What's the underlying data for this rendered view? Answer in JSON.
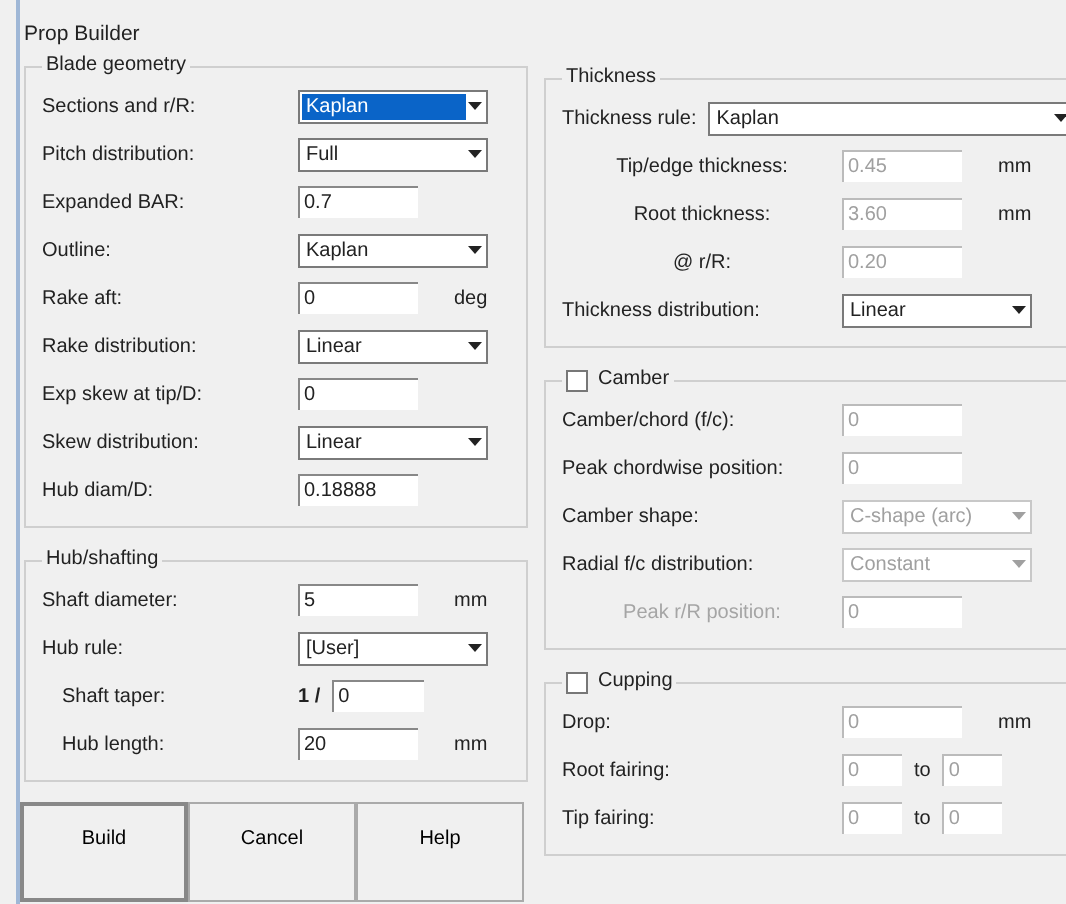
{
  "window": {
    "title": "Prop Builder"
  },
  "left_groups": [
    {
      "title": "Blade geometry",
      "rows": [
        {
          "label": "Sections and r/R:",
          "kind": "combo",
          "value": "Kaplan",
          "focused": true,
          "disabled": false,
          "indented": false
        },
        {
          "label": "Pitch distribution:",
          "kind": "combo",
          "value": "Full",
          "focused": false,
          "disabled": false,
          "indented": false
        },
        {
          "label": "Expanded BAR:",
          "kind": "text",
          "value": "0.7",
          "disabled": false,
          "indented": false
        },
        {
          "label": "Outline:",
          "kind": "combo",
          "value": "Kaplan",
          "focused": false,
          "disabled": false,
          "indented": false
        },
        {
          "label": "Rake aft:",
          "kind": "text",
          "value": "0",
          "unit": "deg",
          "disabled": false,
          "indented": false
        },
        {
          "label": "Rake distribution:",
          "kind": "combo",
          "value": "Linear",
          "focused": false,
          "disabled": false,
          "indented": false
        },
        {
          "label": "Exp skew at tip/D:",
          "kind": "text",
          "value": "0",
          "disabled": false,
          "indented": false
        },
        {
          "label": "Skew distribution:",
          "kind": "combo",
          "value": "Linear",
          "focused": false,
          "disabled": false,
          "indented": false
        },
        {
          "label": "Hub diam/D:",
          "kind": "text",
          "value": "0.18888",
          "disabled": false,
          "indented": false
        }
      ]
    },
    {
      "title": "Hub/shafting",
      "rows": [
        {
          "label": "Shaft diameter:",
          "kind": "text",
          "value": "5",
          "unit": "mm",
          "disabled": false,
          "indented": false
        },
        {
          "label": "Hub rule:",
          "kind": "combo",
          "value": "[User]",
          "focused": false,
          "disabled": false,
          "indented": false
        },
        {
          "label": "Shaft taper:",
          "kind": "ratio",
          "prefix": "1 /",
          "value": "0",
          "disabled": false,
          "indented": true
        },
        {
          "label": "Hub length:",
          "kind": "text",
          "value": "20",
          "unit": "mm",
          "disabled": false,
          "indented": true
        }
      ]
    }
  ],
  "right_groups": [
    {
      "title": "Thickness",
      "rows": [
        {
          "label": "Thickness rule:",
          "kind": "combo_wide",
          "value": "Kaplan",
          "focused": false,
          "disabled": false,
          "indented": false
        },
        {
          "label": "Tip/edge thickness:",
          "kind": "text",
          "value": "0.45",
          "unit": "mm",
          "disabled": true,
          "indented": true
        },
        {
          "label": "Root thickness:",
          "kind": "text",
          "value": "3.60",
          "unit": "mm",
          "disabled": true,
          "indented": true
        },
        {
          "label": "@ r/R:",
          "kind": "text",
          "value": "0.20",
          "disabled": true,
          "indented": true
        },
        {
          "label": "Thickness distribution:",
          "kind": "combo",
          "value": "Linear",
          "focused": false,
          "disabled": false,
          "indented": false
        }
      ]
    },
    {
      "title": "Camber",
      "checked": false,
      "rows": [
        {
          "label": "Camber/chord (f/c):",
          "kind": "text",
          "value": "0",
          "disabled": true,
          "indented": false
        },
        {
          "label": "Peak chordwise position:",
          "kind": "text",
          "value": "0",
          "disabled": true,
          "indented": false
        },
        {
          "label": "Camber shape:",
          "kind": "combo",
          "value": "C-shape (arc)",
          "focused": false,
          "disabled": true,
          "indented": false
        },
        {
          "label": "Radial f/c distribution:",
          "kind": "combo",
          "value": "Constant",
          "focused": false,
          "disabled": true,
          "indented": false
        },
        {
          "label": "Peak r/R position:",
          "kind": "text",
          "value": "0",
          "disabled": true,
          "label_disabled": true,
          "indented": true
        }
      ]
    },
    {
      "title": "Cupping",
      "checked": false,
      "rows": [
        {
          "label": "Drop:",
          "kind": "text",
          "value": "0",
          "unit": "mm",
          "disabled": true,
          "indented": false
        },
        {
          "label": "Root fairing:",
          "kind": "pair",
          "value": "0",
          "joiner": "to",
          "value2": "0",
          "disabled": true,
          "indented": false
        },
        {
          "label": "Tip fairing:",
          "kind": "pair",
          "value": "0",
          "joiner": "to",
          "value2": "0",
          "disabled": true,
          "indented": false
        }
      ]
    }
  ],
  "buttons": [
    {
      "label": "Build",
      "default": true
    },
    {
      "label": "Cancel",
      "default": false
    },
    {
      "label": "Help",
      "default": false
    }
  ]
}
